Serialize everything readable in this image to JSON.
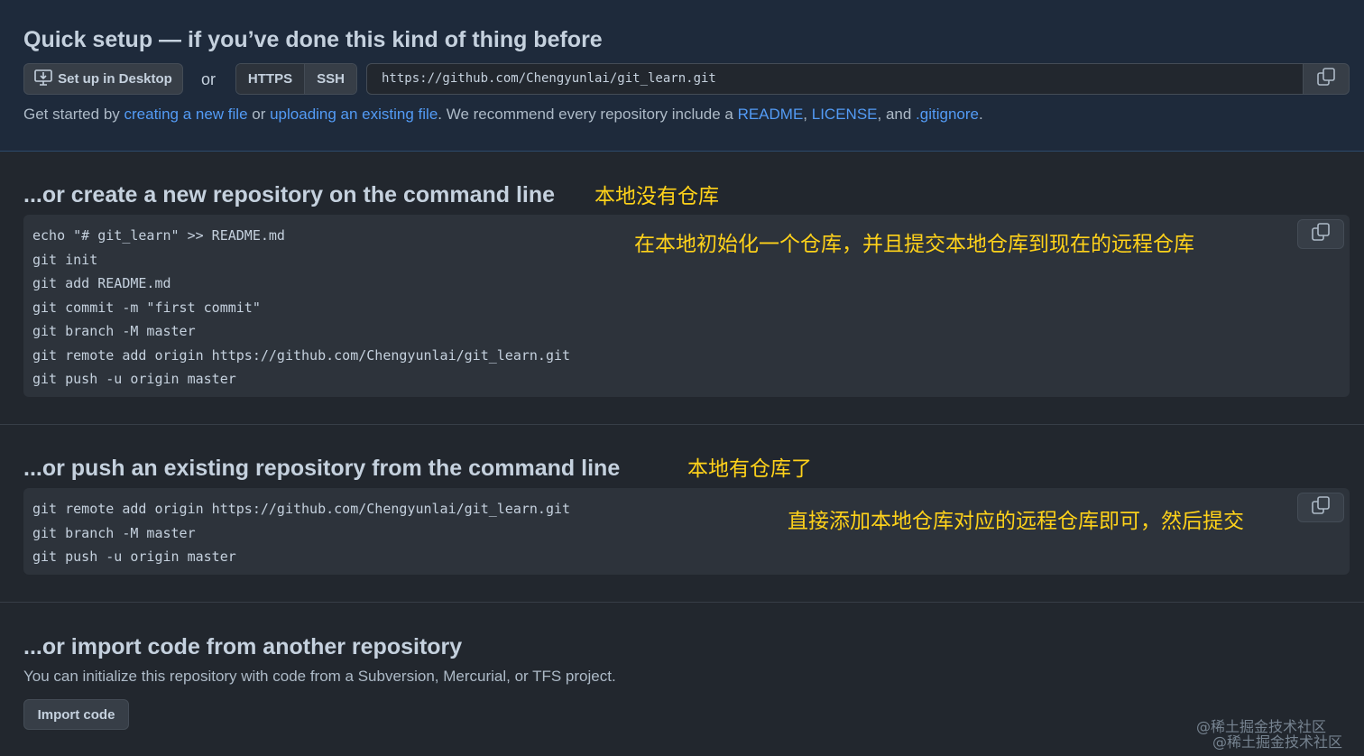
{
  "quick_setup": {
    "title": "Quick setup — if you’ve done this kind of thing before",
    "desktop_button": "Set up in Desktop",
    "or": "or",
    "protocols": [
      "HTTPS",
      "SSH"
    ],
    "clone_url": "https://github.com/Chengyunlai/git_learn.git",
    "get_started": {
      "prefix": "Get started by ",
      "link_new_file": "creating a new file",
      "mid": " or ",
      "link_upload": "uploading an existing file",
      "after": ". We recommend every repository include a ",
      "link_readme": "README",
      "comma": ", ",
      "link_license": "LICENSE",
      "and": ", and ",
      "link_gitignore": ".gitignore",
      "end": "."
    }
  },
  "new_repo": {
    "title": "...or create a new repository on the command line",
    "lines": [
      "echo \"# git_learn\" >> README.md",
      "git init",
      "git add README.md",
      "git commit -m \"first commit\"",
      "git branch -M master",
      "git remote add origin https://github.com/Chengyunlai/git_learn.git",
      "git push -u origin master"
    ],
    "annotation_title": "本地没有仓库",
    "annotation_desc": "在本地初始化一个仓库，并且提交本地仓库到现在的远程仓库"
  },
  "push_repo": {
    "title": "...or push an existing repository from the command line",
    "lines": [
      "git remote add origin https://github.com/Chengyunlai/git_learn.git",
      "git branch -M master",
      "git push -u origin master"
    ],
    "annotation_title": "本地有仓库了",
    "annotation_desc": "直接添加本地仓库对应的远程仓库即可，然后提交"
  },
  "import_repo": {
    "title": "...or import code from another repository",
    "description": "You can initialize this repository with code from a Subversion, Mercurial, or TFS project.",
    "button": "Import code"
  },
  "watermark": "@稀土掘金技术社区",
  "icons": {
    "desktop": "desktop-download-icon",
    "copy": "copy-icon"
  },
  "colors": {
    "link": "#539bf5",
    "annotation": "#ffd21a",
    "header_bg": "#1e2a3b"
  }
}
